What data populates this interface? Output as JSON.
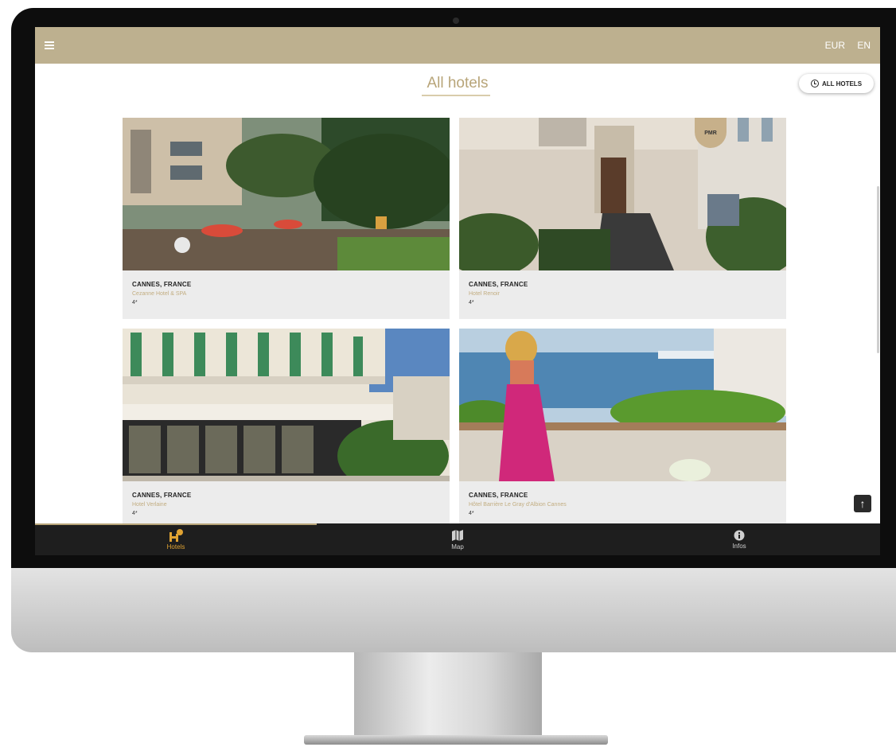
{
  "header": {
    "currency": "EUR",
    "language": "EN",
    "menu_icon": "hamburger-icon"
  },
  "page": {
    "title": "All hotels",
    "filter_button_label": "ALL HOTELS",
    "filter_button_icon": "clock-icon"
  },
  "hotels": [
    {
      "city": "CANNES, FRANCE",
      "name": "Cezanne Hotel & SPA",
      "stars": "4*"
    },
    {
      "city": "CANNES, FRANCE",
      "name": "Hotel Renoir",
      "stars": "4*",
      "badge": "PMR"
    },
    {
      "city": "CANNES, FRANCE",
      "name": "Hotel Verlaine",
      "stars": "4*"
    },
    {
      "city": "CANNES, FRANCE",
      "name": "Hôtel Barrière Le Gray d'Albion Cannes",
      "stars": "4*"
    }
  ],
  "bottom_nav": {
    "items": [
      {
        "label": "Hotels",
        "icon": "hotel-icon",
        "active": true
      },
      {
        "label": "Map",
        "icon": "map-icon",
        "active": false
      },
      {
        "label": "Infos",
        "icon": "info-icon",
        "active": false
      }
    ]
  },
  "colors": {
    "topbar": "#bdb08f",
    "accent": "#b8a579",
    "active_nav": "#e0a332",
    "nav_background": "#1e1e1e"
  }
}
